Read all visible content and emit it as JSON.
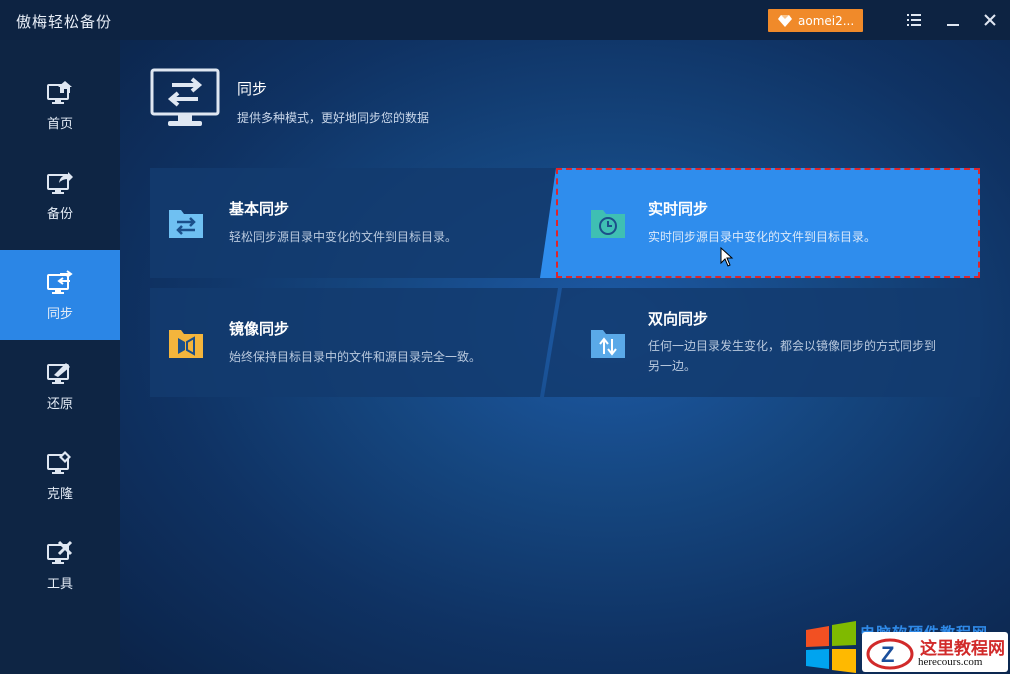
{
  "window": {
    "title": "傲梅轻松备份",
    "account_label": "aomei2...",
    "menu_icon": "menu-icon",
    "minimize_icon": "minimize-icon",
    "close_icon": "close-icon"
  },
  "sidebar": {
    "items": [
      {
        "label": "首页",
        "icon": "home-monitor-icon",
        "active": false
      },
      {
        "label": "备份",
        "icon": "backup-monitor-icon",
        "active": false
      },
      {
        "label": "同步",
        "icon": "sync-monitor-icon",
        "active": true
      },
      {
        "label": "还原",
        "icon": "restore-monitor-icon",
        "active": false
      },
      {
        "label": "克隆",
        "icon": "clone-monitor-icon",
        "active": false
      },
      {
        "label": "工具",
        "icon": "tools-monitor-icon",
        "active": false
      }
    ]
  },
  "header": {
    "title": "同步",
    "subtitle": "提供多种模式，更好地同步您的数据"
  },
  "cards": [
    {
      "title": "基本同步",
      "desc": "轻松同步源目录中变化的文件到目标目录。",
      "icon": "basic-sync-folder-icon"
    },
    {
      "title": "实时同步",
      "desc": "实时同步源目录中变化的文件到目标目录。",
      "icon": "realtime-sync-folder-icon",
      "highlighted": true
    },
    {
      "title": "镜像同步",
      "desc": "始终保持目标目录中的文件和源目录完全一致。",
      "icon": "mirror-sync-folder-icon"
    },
    {
      "title": "双向同步",
      "desc_line1": "任何一边目录发生变化，都会以镜像同步的方式同步到",
      "desc_line2": "另一边。",
      "icon": "two-way-sync-folder-icon"
    }
  ],
  "watermark": {
    "top_text": "电脑软硬件教程网",
    "title": "这里教程网",
    "url": "herecours.com"
  },
  "colors": {
    "accent": "#2b86e6",
    "account_button": "#f08a2a",
    "highlight_border": "#e0242a"
  }
}
